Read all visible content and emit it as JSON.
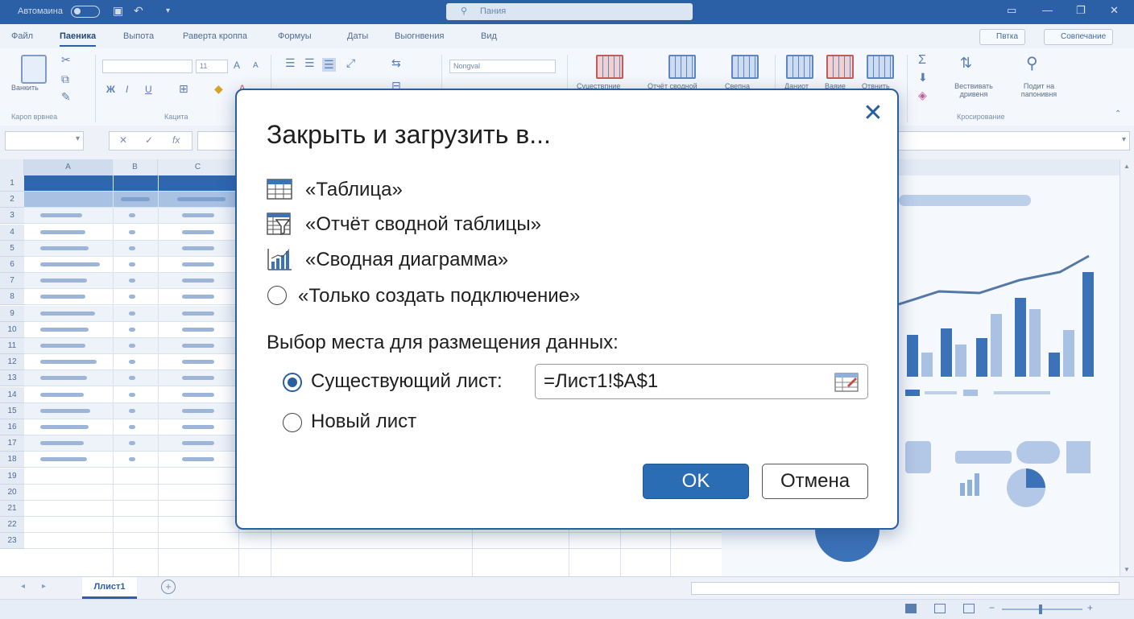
{
  "window": {
    "autosave_label": "Автомаина",
    "search_placeholder": "Пания"
  },
  "ribbon": {
    "tabs": [
      "Файл",
      "Паеника",
      "Выпота",
      "Раверта кроппа",
      "Формуы",
      "Даты",
      "Выогнвения",
      "Вид"
    ],
    "active_tab": "Паеника",
    "share_label": "Пвтка",
    "comments_label": "Совпечание",
    "clipboard": {
      "paste_label": "Ванкить",
      "group_label": "Кароп врвнеа"
    },
    "font": {
      "size": "11",
      "group_label": "Кацита"
    },
    "number_format": "Nongval",
    "styles_labels": [
      "Суцествпние",
      "Отчёт сводной",
      "Свепна"
    ],
    "cells_labels": [
      "Даниот",
      "Ваяие",
      "Отвнить"
    ],
    "editing": {
      "sort_label": "Вествивать дривеня",
      "find_label": "Подит на папонивня",
      "group_label": "Кросирование"
    }
  },
  "sheet": {
    "columns": [
      "A",
      "B",
      "C"
    ],
    "rows": [
      "1",
      "2",
      "3",
      "4",
      "5",
      "6",
      "7",
      "8",
      "9",
      "10",
      "11",
      "12",
      "13",
      "14",
      "15",
      "16",
      "17",
      "18",
      "19",
      "20",
      "21",
      "22",
      "23"
    ],
    "tab_name": "Ллист1"
  },
  "dialog": {
    "title": "Закрыть и загрузить в...",
    "options": [
      {
        "label": "«Таблица»",
        "icon": "table-icon"
      },
      {
        "label": "«Отчёт сводной таблицы»",
        "icon": "pivot-table-icon"
      },
      {
        "label": "«Сводная диаграмма»",
        "icon": "pivot-chart-icon"
      },
      {
        "label": "«Только создать подключение»",
        "icon": "radio"
      }
    ],
    "placement_label": "Выбор места для размещения данных:",
    "existing_sheet_label": "Существующий лист:",
    "existing_sheet_selected": true,
    "range_value": "=Лист1!$A$1",
    "new_sheet_label": "Новый лист",
    "ok_label": "OK",
    "cancel_label": "Отмена",
    "accent_color": "#2a5f9e"
  }
}
